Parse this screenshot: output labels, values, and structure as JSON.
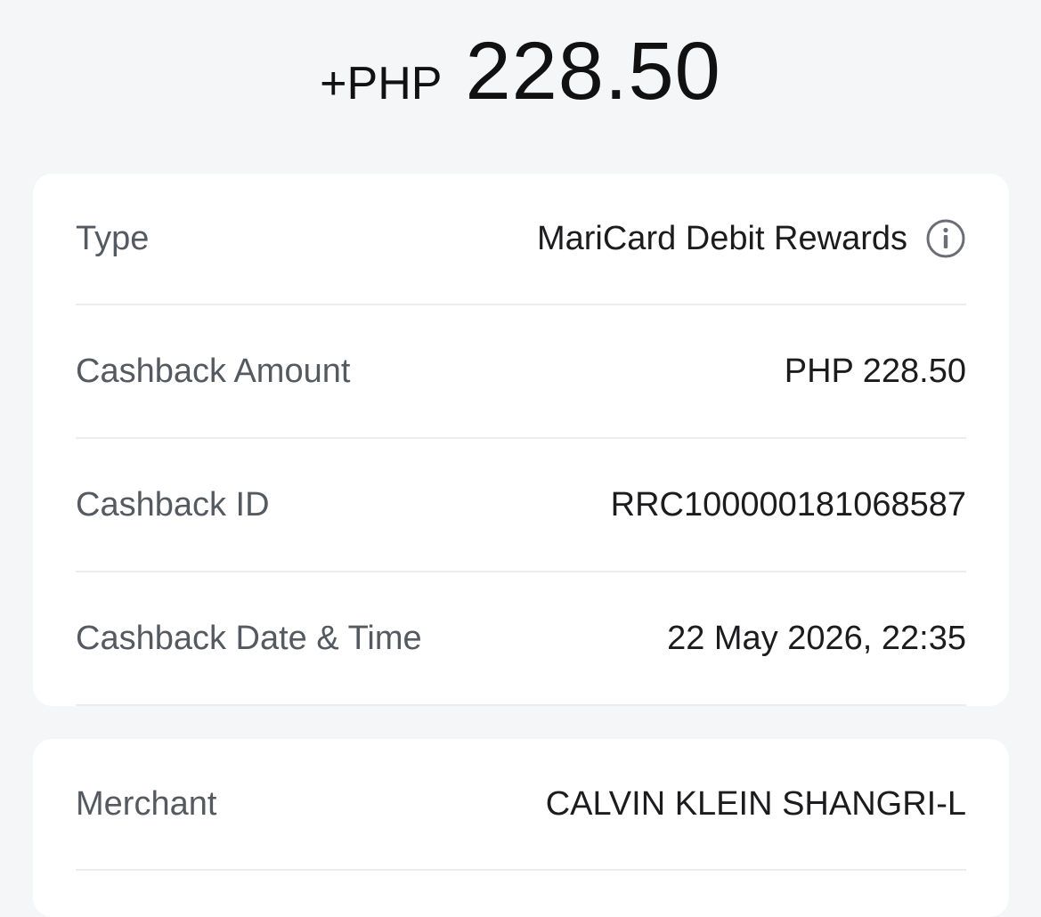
{
  "header": {
    "amount_prefix": "+PHP",
    "amount_value": "228.50"
  },
  "details": {
    "rows": [
      {
        "label": "Type",
        "value": "MariCard Debit Rewards",
        "icon": "info-icon"
      },
      {
        "label": "Cashback Amount",
        "value": "PHP 228.50"
      },
      {
        "label": "Cashback ID",
        "value": "RRC100000181068587"
      },
      {
        "label": "Cashback Date & Time",
        "value": "22 May 2026, 22:35"
      }
    ]
  },
  "merchant": {
    "label": "Merchant",
    "value": "CALVIN KLEIN SHANGRI-L"
  },
  "colors": {
    "background": "#f5f6f8",
    "card": "#ffffff",
    "label": "#555a60",
    "value": "#1c1c1e",
    "divider": "#ececee"
  }
}
